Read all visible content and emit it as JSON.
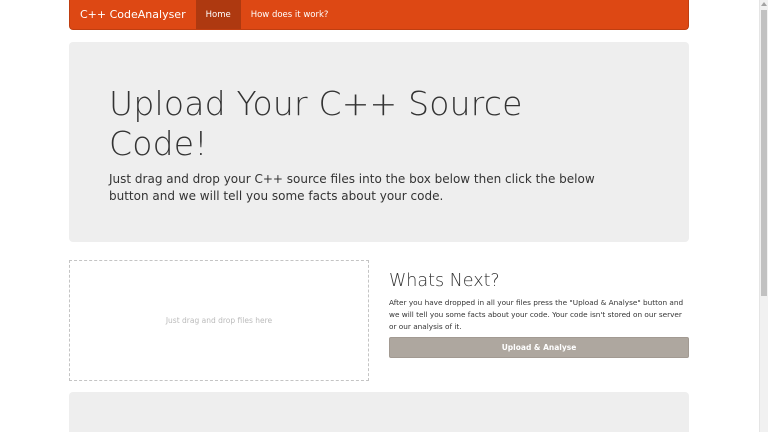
{
  "navbar": {
    "brand": "C++ CodeAnalyser",
    "items": [
      {
        "label": "Home",
        "active": true
      },
      {
        "label": "How does it work?",
        "active": false
      }
    ],
    "color": "#dd4814",
    "active_color": "#ae3910"
  },
  "hero": {
    "title": "Upload Your C++ Source Code!",
    "text": "Just drag and drop your C++ source files into the box below then click the below button and we will tell you some facts about your code."
  },
  "dropzone": {
    "text": "Just drag and drop files here"
  },
  "whats_next": {
    "title": "Whats Next?",
    "text": "After you have dropped in all your files press the \"Upload & Analyse\" button and we will tell you some facts about your code. Your code isn't stored on our server or our analysis of it.",
    "button_label": "Upload & Analyse",
    "button_color": "#aea79f"
  }
}
